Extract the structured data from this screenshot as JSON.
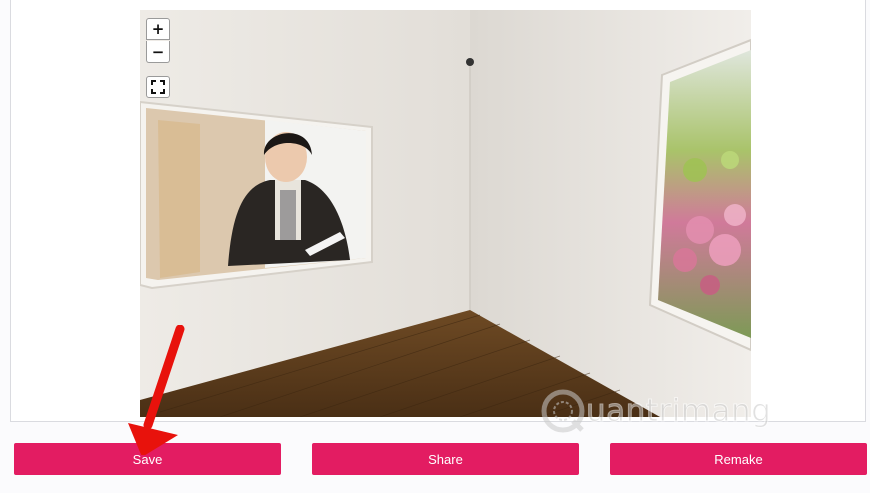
{
  "viewer": {
    "zoom_in_label": "+",
    "zoom_out_label": "−",
    "fullscreen_icon": "fullscreen-icon",
    "left_artwork": "portrait-photo",
    "right_artwork": "cherry-blossom-photo"
  },
  "actions": {
    "save_label": "Save",
    "share_label": "Share",
    "remake_label": "Remake"
  },
  "watermark": {
    "text": "uantrimang",
    "icon": "quantrimang-logo-icon"
  },
  "annotation": {
    "icon": "red-arrow-icon",
    "color": "#e8120c"
  },
  "colors": {
    "button": "#e31c62",
    "button_text": "#ffffff"
  }
}
